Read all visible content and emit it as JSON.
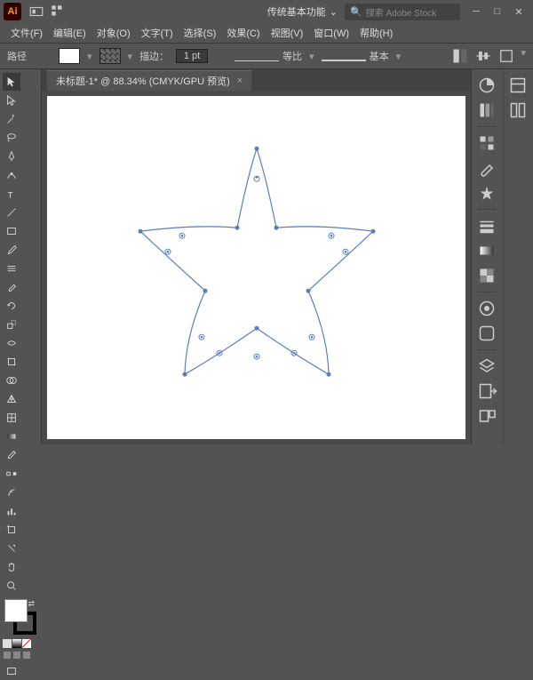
{
  "app": {
    "logo": "Ai"
  },
  "workspace_selector": "传统基本功能",
  "search_placeholder": "搜索 Adobe Stock",
  "menu": [
    "文件(F)",
    "编辑(E)",
    "对象(O)",
    "文字(T)",
    "选择(S)",
    "效果(C)",
    "视图(V)",
    "窗口(W)",
    "帮助(H)"
  ],
  "control": {
    "label": "路径",
    "stroke_label": "描边：",
    "stroke_value": "1 pt",
    "profile_label": "等比",
    "style_label": "基本"
  },
  "document": {
    "tab_title": "未标题-1* @ 88.34% (CMYK/GPU 预览)"
  },
  "chart_data": {
    "type": "star-path",
    "points": 5,
    "outer_radius": 140,
    "inner_radius": 62,
    "corner_handles": true
  }
}
